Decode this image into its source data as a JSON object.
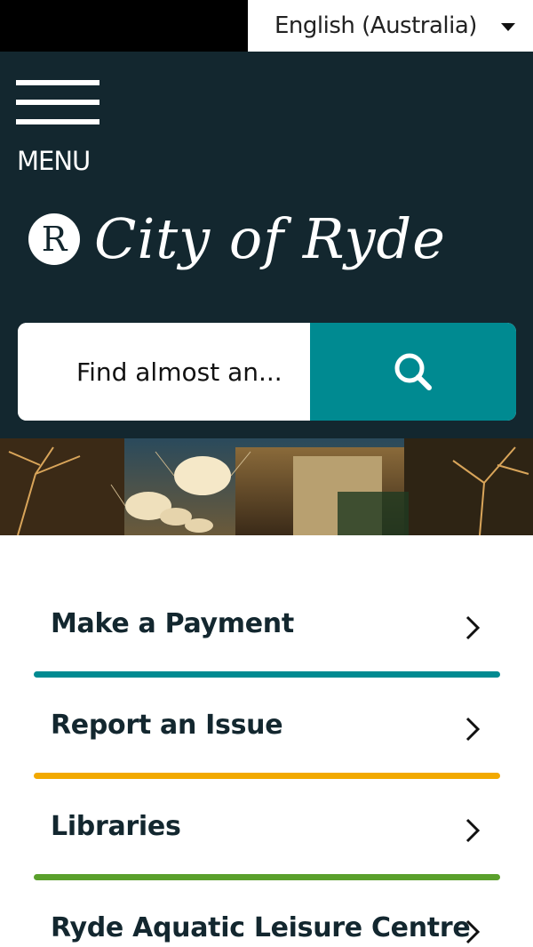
{
  "language_selector": {
    "label": "English (Australia)"
  },
  "header": {
    "menu_label": "MENU",
    "logo_mark": "R",
    "logo_text": "City of Ryde"
  },
  "search": {
    "placeholder": "Find almost an..."
  },
  "quick_links": [
    {
      "label": "Make a Payment",
      "accent": "#008a91"
    },
    {
      "label": "Report an Issue",
      "accent": "#f2a900"
    },
    {
      "label": "Libraries",
      "accent": "#5aa02c"
    },
    {
      "label": "Ryde Aquatic Leisure Centre",
      "accent": "#13272f"
    }
  ],
  "colors": {
    "header_bg": "#13272f",
    "search_button": "#008a91",
    "top_bar": "#000000"
  },
  "icons": {
    "menu": "hamburger-icon",
    "search": "magnifier-icon",
    "language": "caret-down-icon",
    "link": "chevron-right-icon"
  }
}
